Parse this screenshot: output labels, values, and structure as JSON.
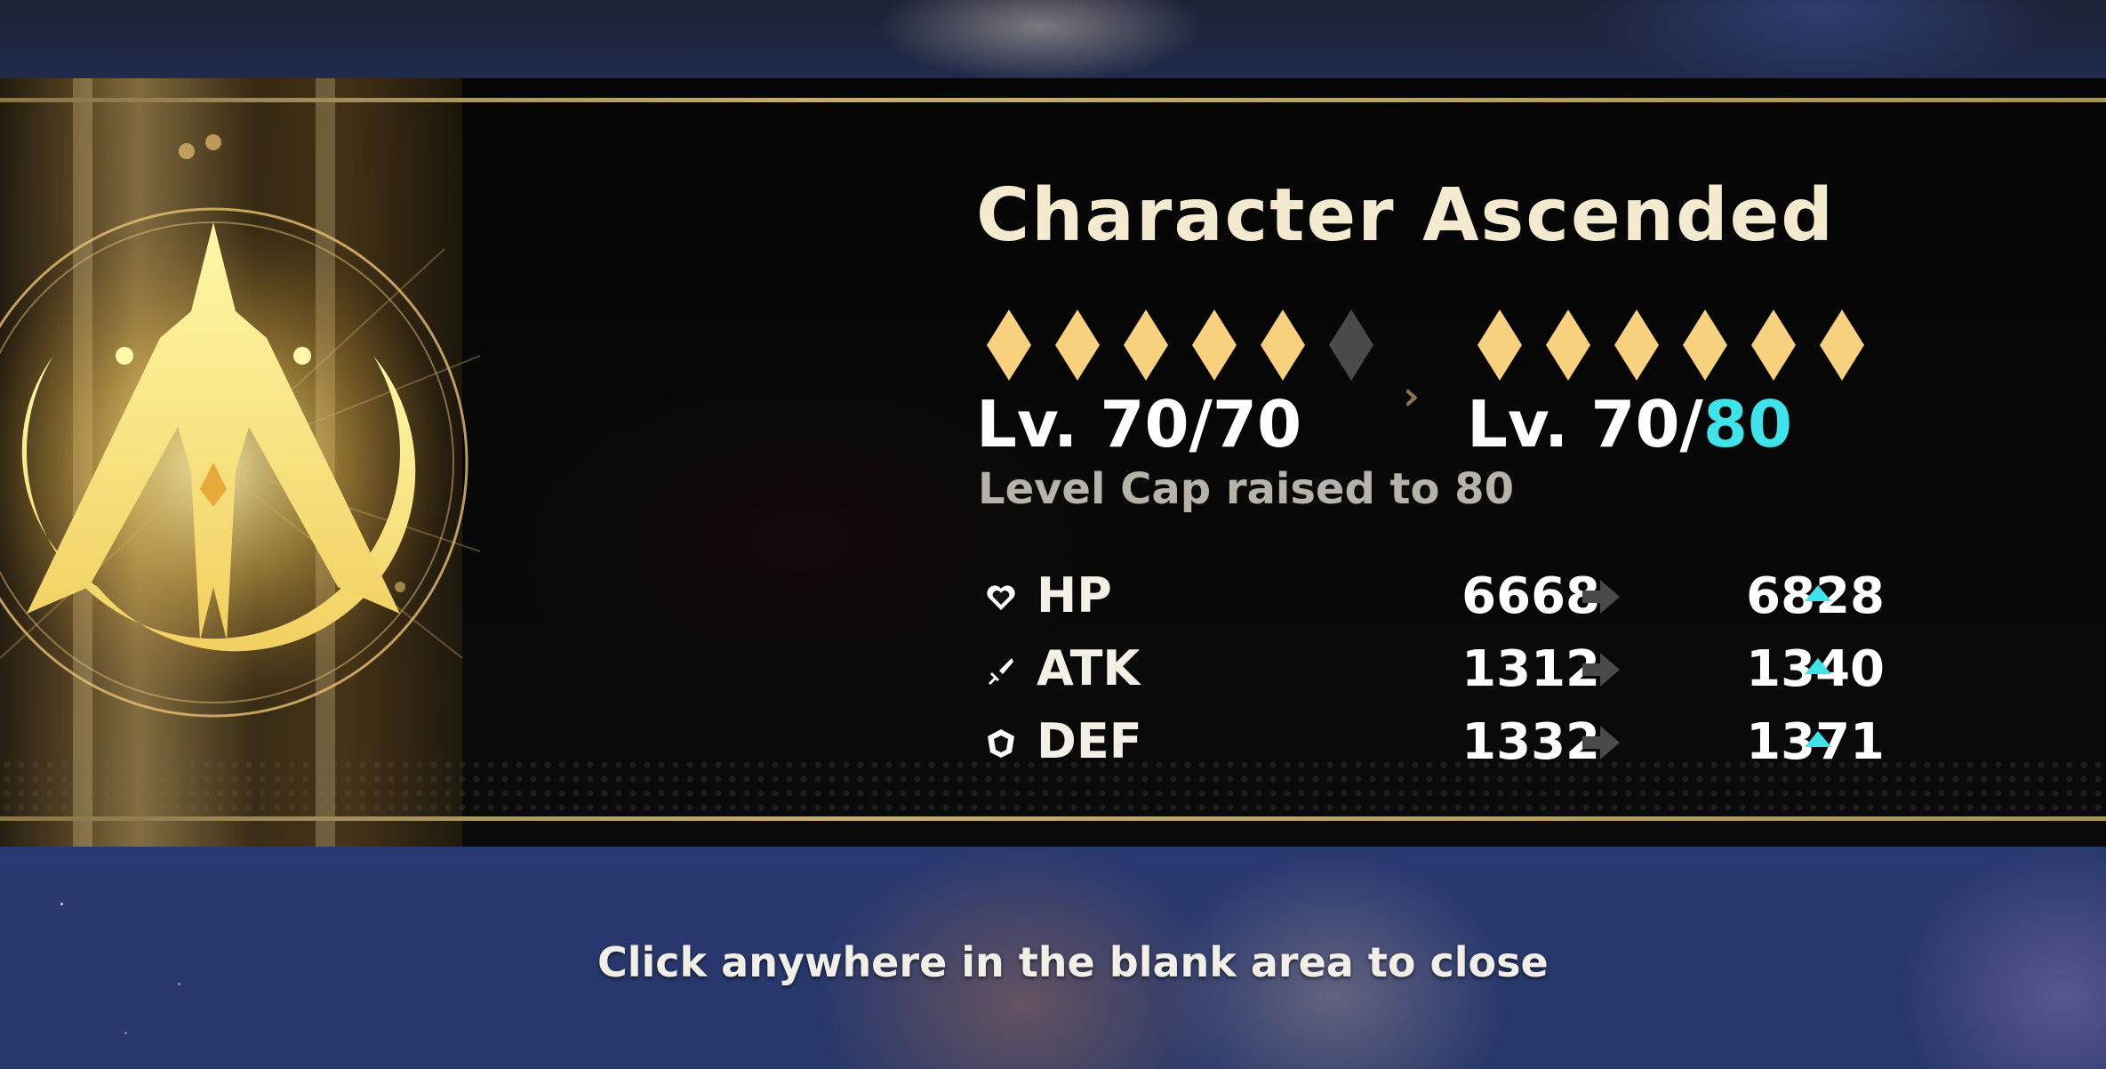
{
  "header": {
    "title": "Character Ascended"
  },
  "ascension": {
    "stars_before": {
      "filled": 5,
      "total": 6
    },
    "stars_after": {
      "filled": 6,
      "total": 6
    },
    "level_before": "Lv. 70/70",
    "level_after_prefix": "Lv. 70/",
    "level_after_cap": "80",
    "cap_note": "Level Cap raised to 80"
  },
  "stats": [
    {
      "name": "HP",
      "icon": "heart-icon",
      "old": "6668",
      "new": "6828"
    },
    {
      "name": "ATK",
      "icon": "sword-icon",
      "old": "1312",
      "new": "1340"
    },
    {
      "name": "DEF",
      "icon": "shield-icon",
      "old": "1332",
      "new": "1371"
    }
  ],
  "footer": {
    "close_hint": "Click anywhere in the blank area to close"
  },
  "colors": {
    "gold": "#f8d17f",
    "gold_line": "#c6ad78",
    "accent_cyan": "#3fe3ea",
    "empty_star": "#4a4a4a"
  }
}
